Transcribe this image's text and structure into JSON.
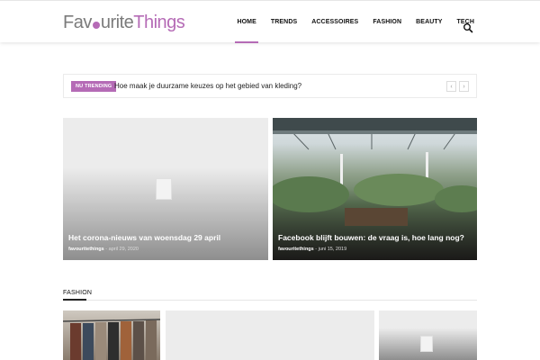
{
  "logo": {
    "part1": "Fav",
    "part2": "urite",
    "part3": "Things"
  },
  "nav": {
    "items": [
      {
        "label": "HOME"
      },
      {
        "label": "TRENDS"
      },
      {
        "label": "ACCESSOIRES"
      },
      {
        "label": "FASHION"
      },
      {
        "label": "BEAUTY"
      },
      {
        "label": "TECH"
      }
    ],
    "search_icon": "search-icon"
  },
  "trending": {
    "badge": "NU TRENDING",
    "text": "Hoe maak je duurzame keuzes op het gebied van kleding?",
    "prev_icon": "chevron-left-icon",
    "next_icon": "chevron-right-icon"
  },
  "featured": [
    {
      "title": "Het corona-nieuws van woensdag 29 april",
      "author": "favouritethings",
      "date": "april 29, 2020"
    },
    {
      "title": "Facebook blijft bouwen: de vraag is, hoe lang nog?",
      "author": "favouritethings",
      "date": "juni 15, 2019"
    }
  ],
  "section": {
    "label": "FASHION"
  },
  "colors": {
    "accent": "#b56bb6",
    "text": "#222222"
  }
}
